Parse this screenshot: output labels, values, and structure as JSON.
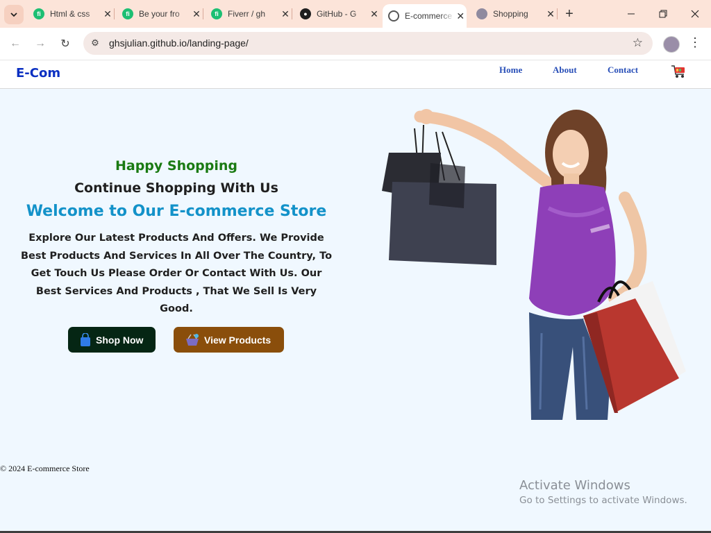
{
  "browser": {
    "tabs": [
      {
        "title": "Html & css",
        "favicon": "fiverr-icon"
      },
      {
        "title": "Be your fro",
        "favicon": "fiverr-icon"
      },
      {
        "title": "Fiverr / gh",
        "favicon": "fiverr-icon"
      },
      {
        "title": "GitHub - G",
        "favicon": "github-icon"
      },
      {
        "title": "E-commerce",
        "favicon": "globe-icon",
        "active": true
      },
      {
        "title": "Shopping",
        "favicon": "person-icon"
      }
    ],
    "url": "ghsjulian.github.io/landing-page/"
  },
  "site": {
    "brand": "E-Com",
    "nav": [
      "Home",
      "About",
      "Contact"
    ],
    "cart_icon": "shopping-cart-icon"
  },
  "hero": {
    "tagline": "Happy Shopping",
    "subheading": "Continue Shopping With Us",
    "heading": "Welcome to Our E-commerce Store",
    "description": "Explore Our Latest Products And Offers. We Provide Best Products And Services In All Over The Country, To Get Touch Us Please Order Or Contact With Us. Our Best Services And Products , That We Sell Is Very Good.",
    "buttons": [
      {
        "label": "Shop Now",
        "icon": "shopping-bag-icon"
      },
      {
        "label": "View Products",
        "icon": "basket-icon"
      }
    ]
  },
  "footer": {
    "text": "© 2024 E-commerce Store"
  },
  "os_overlay": {
    "title": "Activate Windows",
    "subtitle": "Go to Settings to activate Windows."
  },
  "colors": {
    "brand": "#0b30c2",
    "tagline": "#1a7a12",
    "heading": "#1392c9",
    "shop_button": "#052614",
    "view_button": "#8a4e0b",
    "page_bg": "#f0f8ff"
  }
}
